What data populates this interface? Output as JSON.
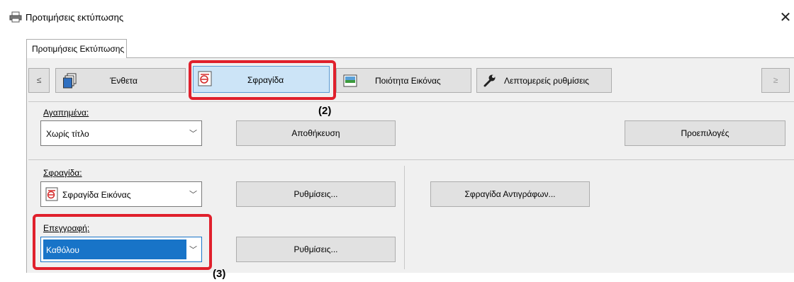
{
  "window": {
    "title": "Προτιμήσεις εκτύπωσης",
    "close_glyph": "✕",
    "icon": "printer-icon"
  },
  "tab": {
    "label": "Προτιμήσεις Εκτύπωσης"
  },
  "nav": {
    "prev_glyph": "≤",
    "next_glyph": "≥",
    "buttons": [
      {
        "label": "Ένθετα",
        "icon": "pages-icon"
      },
      {
        "label": "Σφραγίδα",
        "icon": "stamp-icon"
      },
      {
        "label": "Ποιότητα Εικόνας",
        "icon": "image-quality-icon"
      },
      {
        "label": "Λεπτομερείς ρυθμίσεις",
        "icon": "wrench-icon"
      }
    ]
  },
  "favorites": {
    "label": "Αγαπημένα:",
    "value": "Χωρίς τίτλο",
    "save_label": "Αποθήκευση",
    "defaults_label": "Προεπιλογές"
  },
  "stamp": {
    "label": "Σφραγίδα:",
    "value": "Σφραγίδα Εικόνας",
    "settings_label": "Ρυθμίσεις...",
    "copy_stamp_label": "Σφραγίδα Αντιγράφων..."
  },
  "overlay": {
    "label": "Επεγγραφή:",
    "value": "Καθόλου",
    "settings_label": "Ρυθμίσεις..."
  },
  "callouts": {
    "two": "(2)",
    "three": "(3)"
  },
  "colors": {
    "highlight": "#e0202c",
    "selected": "#1874c8",
    "active_button": "#cce4f7"
  }
}
